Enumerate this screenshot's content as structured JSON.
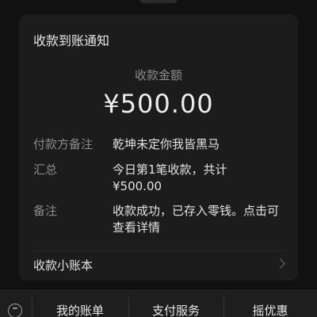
{
  "card": {
    "title": "收款到账通知",
    "amount_label": "收款金额",
    "amount_value": "¥500.00",
    "payer_label": "付款方备注",
    "payer_value": "乾坤未定你我皆黑马",
    "summary_label": "汇总",
    "summary_value": "今日第1笔收款，共计",
    "summary_amount": "¥500.00",
    "remark_label": "备注",
    "remark_value": "收款成功，已存入零钱。点击可查看详情",
    "ledger_link": "收款小账本"
  },
  "bottom_menu": {
    "items": [
      {
        "label": "我的账单"
      },
      {
        "label": "支付服务"
      },
      {
        "label": "摇优惠"
      }
    ]
  }
}
